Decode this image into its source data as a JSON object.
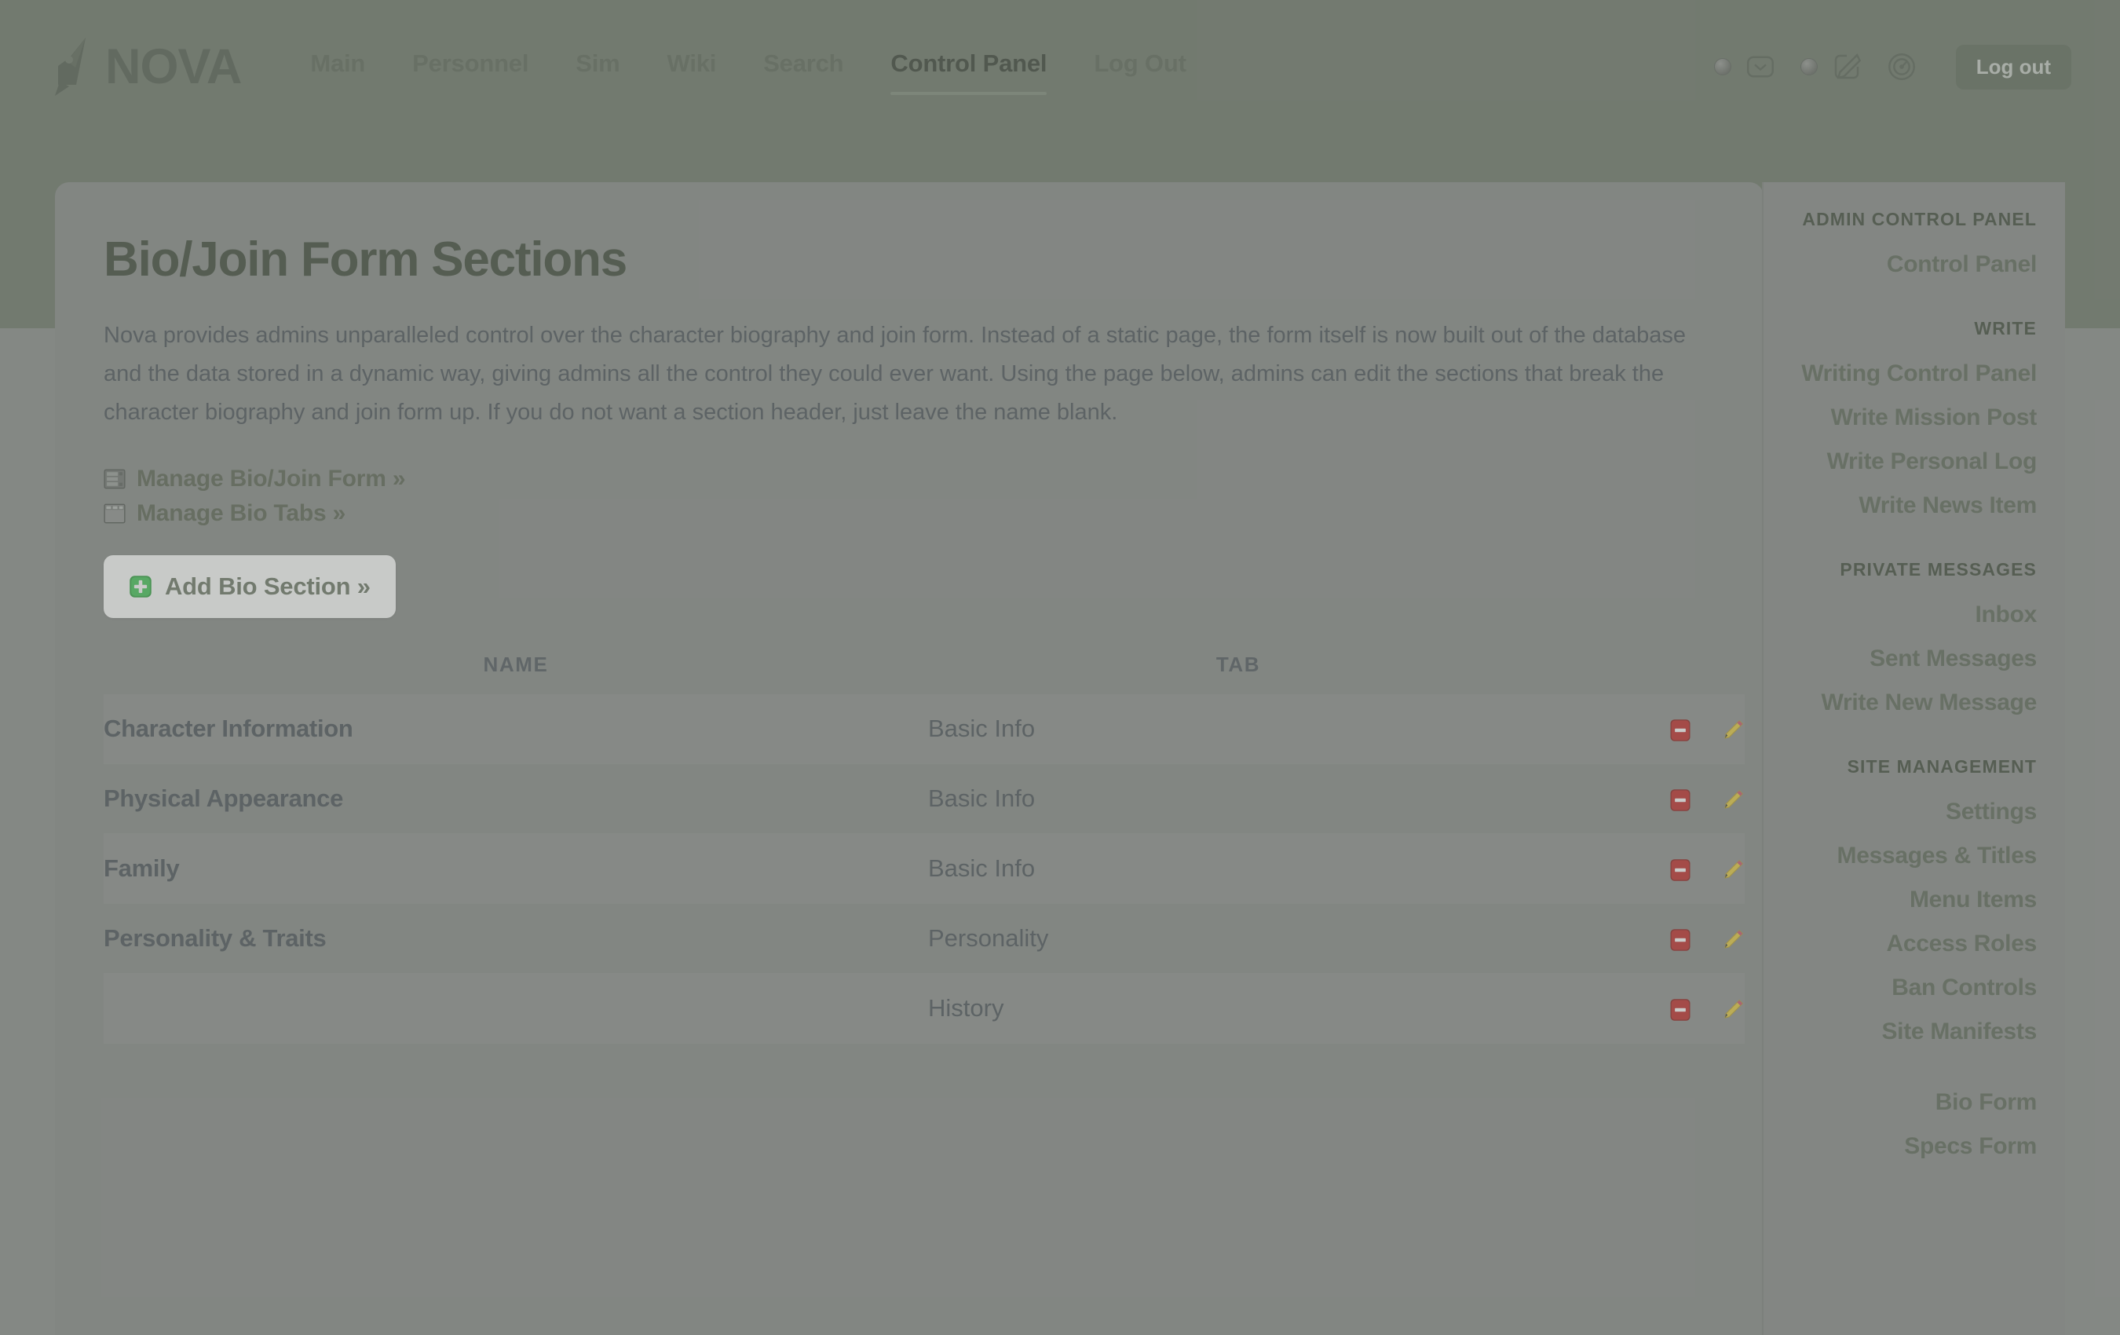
{
  "header": {
    "logo_text": "NOVA",
    "logo_icon": "pen-nib-icon",
    "nav": [
      {
        "label": "Main",
        "active": false
      },
      {
        "label": "Personnel",
        "active": false
      },
      {
        "label": "Sim",
        "active": false
      },
      {
        "label": "Wiki",
        "active": false
      },
      {
        "label": "Search",
        "active": false
      },
      {
        "label": "Control Panel",
        "active": true
      },
      {
        "label": "Log Out",
        "active": false
      }
    ],
    "tools": [
      {
        "icon": "envelope-icon",
        "name": "messages-icon"
      },
      {
        "icon": "pencil-square-icon",
        "name": "write-icon"
      },
      {
        "icon": "gauge-icon",
        "name": "dashboard-icon"
      }
    ],
    "logout_label": "Log out"
  },
  "main": {
    "title": "Bio/Join Form Sections",
    "intro": "Nova provides admins unparalleled control over the character biography and join form. Instead of a static page, the form itself is now built out of the database and the data stored in a dynamic way, giving admins all the control they could ever want. Using the page below, admins can edit the sections that break the character biography and join form up. If you do not want a section header, just leave the name blank.",
    "links": [
      {
        "label": "Manage Bio/Join Form »",
        "icon": "form-layout-icon"
      },
      {
        "label": "Manage Bio Tabs »",
        "icon": "tabs-icon"
      }
    ],
    "add_button": {
      "label": "Add Bio Section »",
      "icon": "plus-square-icon",
      "icon_color": "#3bb34a"
    },
    "table": {
      "columns": [
        "NAME",
        "TAB",
        ""
      ],
      "rows": [
        {
          "name": "Character Information",
          "tab": "Basic Info",
          "delete_icon": "delete-icon",
          "edit_icon": "edit-pencil-icon"
        },
        {
          "name": "Physical Appearance",
          "tab": "Basic Info",
          "delete_icon": "delete-icon",
          "edit_icon": "edit-pencil-icon"
        },
        {
          "name": "Family",
          "tab": "Basic Info",
          "delete_icon": "delete-icon",
          "edit_icon": "edit-pencil-icon"
        },
        {
          "name": "Personality & Traits",
          "tab": "Personality",
          "delete_icon": "delete-icon",
          "edit_icon": "edit-pencil-icon"
        },
        {
          "name": "",
          "tab": "History",
          "delete_icon": "delete-icon",
          "edit_icon": "edit-pencil-icon"
        }
      ]
    }
  },
  "sidebar": {
    "groups": [
      {
        "heading": "ADMIN CONTROL PANEL",
        "items": [
          {
            "label": "Control Panel"
          }
        ]
      },
      {
        "heading": "WRITE",
        "items": [
          {
            "label": "Writing Control Panel"
          },
          {
            "label": "Write Mission Post"
          },
          {
            "label": "Write Personal Log"
          },
          {
            "label": "Write News Item"
          }
        ]
      },
      {
        "heading": "PRIVATE MESSAGES",
        "items": [
          {
            "label": "Inbox"
          },
          {
            "label": "Sent Messages"
          },
          {
            "label": "Write New Message"
          }
        ]
      },
      {
        "heading": "SITE MANAGEMENT",
        "items": [
          {
            "label": "Settings"
          },
          {
            "label": "Messages & Titles"
          },
          {
            "label": "Menu Items"
          },
          {
            "label": "Access Roles"
          },
          {
            "label": "Ban Controls"
          },
          {
            "label": "Site Manifests"
          }
        ]
      },
      {
        "heading": "",
        "items": [
          {
            "label": "Bio Form"
          },
          {
            "label": "Specs Form"
          }
        ]
      }
    ]
  },
  "colors": {
    "header_green": "#6c7567",
    "page_gray": "#8a8d8a",
    "card_gray": "#878a87",
    "title_green": "#3a4434",
    "link_green": "#5a6455",
    "delete_red": "#b5201f",
    "edit_yellow": "#e6c832",
    "add_green": "#3bb34a"
  }
}
